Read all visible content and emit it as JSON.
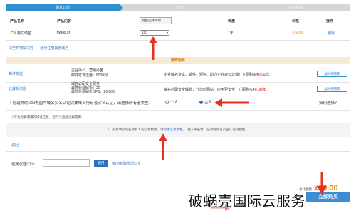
{
  "steps": [
    "确认订单",
    "支付",
    "支付完成"
  ],
  "table": {
    "headers": [
      "产品名称",
      "产品内容",
      "优惠",
      "价格",
      "操作"
    ],
    "filter_placeholder": "批量选择年限",
    "row": {
      "product": ".CN 英文域名",
      "content": "fjwj88.cn",
      "year_select": "1年",
      "period": "1年",
      "price": "¥29.00",
      "action": "删除"
    }
  },
  "links": [
    "清空购物车内容",
    "继续注册其他域名"
  ],
  "recommend_title": "推荐服务",
  "services": [
    {
      "name": "邮件精选",
      "detail_lines": [
        "企业办公、营销必备",
        "邮件可发送量：8000封"
      ],
      "desc_prefix": "企业域名专享、邮件、短信、助力企业办公营销！立即购买",
      "desc_price": "¥0.00/年",
      "add_label": "加入购物车"
    },
    {
      "name": "云解析增强",
      "detail_lines": [
        "域名必配安全服务",
        "最高免费解析：20",
        "最低免费解析QPS：20,000"
      ],
      "desc_prefix": "域名必配安全解析，让您的网站、应用更安全！立即购买",
      "desc_price": "¥0.00/年",
      "add_label": "加入购物车"
    }
  ],
  "holder": {
    "question": "* 您选购的.CN等国内域名实名认证需要域名持有者实名认证，请选择所有者类型：",
    "options": [
      "个人",
      "企业"
    ],
    "selected": "企业",
    "help": "如何选择？"
  },
  "note": "以下为您要使用的域名信息，您可以直接选择使用：",
  "notice": {
    "prefix": "*，没有填写域名持有人的信息模板，请",
    "link": "创建信息模板",
    "suffix": "。（持入域名时，必须使用已实名认证的模板）"
  },
  "back": "返回",
  "coupon": {
    "label": "使用优惠口令：",
    "use": "使用",
    "get": "如何获取优惠口令"
  },
  "total": {
    "label": "总计金额",
    "amount": "¥29.00"
  },
  "pay_button": "立即购买",
  "watermark": "破蜗壳国际云服务",
  "colors": {
    "accent": "#2f8fcf",
    "price": "#f08b00",
    "arrow": "#e8321e"
  }
}
